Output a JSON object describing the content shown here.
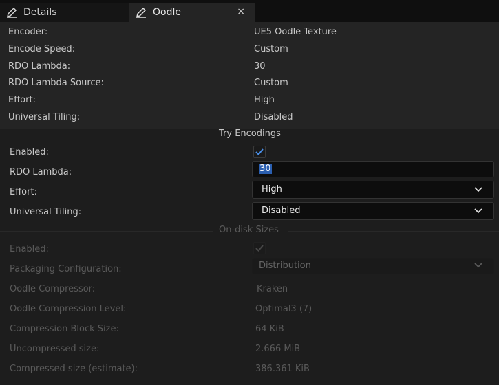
{
  "tabs": [
    {
      "label": "Details",
      "icon": "pencil-icon"
    },
    {
      "label": "Oodle",
      "icon": "pencil-icon",
      "close": "×"
    }
  ],
  "info": [
    {
      "label": "Encoder:",
      "value": "UE5 Oodle Texture"
    },
    {
      "label": "Encode Speed:",
      "value": "Custom"
    },
    {
      "label": "RDO Lambda:",
      "value": "30"
    },
    {
      "label": "RDO Lambda Source:",
      "value": "Custom"
    },
    {
      "label": "Effort:",
      "value": "High"
    },
    {
      "label": "Universal Tiling:",
      "value": "Disabled"
    }
  ],
  "try_encodings": {
    "title": "Try Encodings",
    "enabled_label": "Enabled:",
    "enabled_checked": true,
    "rdo_label": "RDO Lambda:",
    "rdo_value": "30",
    "effort_label": "Effort:",
    "effort_value": "High",
    "tiling_label": "Universal Tiling:",
    "tiling_value": "Disabled"
  },
  "on_disk": {
    "title": "On-disk Sizes",
    "enabled_label": "Enabled:",
    "enabled_checked": true,
    "packaging_label": "Packaging Configuration:",
    "packaging_value": "Distribution",
    "rows": [
      {
        "label": "Oodle Compressor:",
        "value": "Kraken"
      },
      {
        "label": "Oodle Compression Level:",
        "value": "Optimal3 (7)"
      },
      {
        "label": "Compression Block Size:",
        "value": "64 KiB"
      },
      {
        "label": "Uncompressed size:",
        "value": "2.666 MiB"
      },
      {
        "label": "Compressed size (estimate):",
        "value": "386.361 KiB"
      }
    ]
  },
  "colors": {
    "accent": "#2b5fb0",
    "check": "#4a8fe8"
  }
}
